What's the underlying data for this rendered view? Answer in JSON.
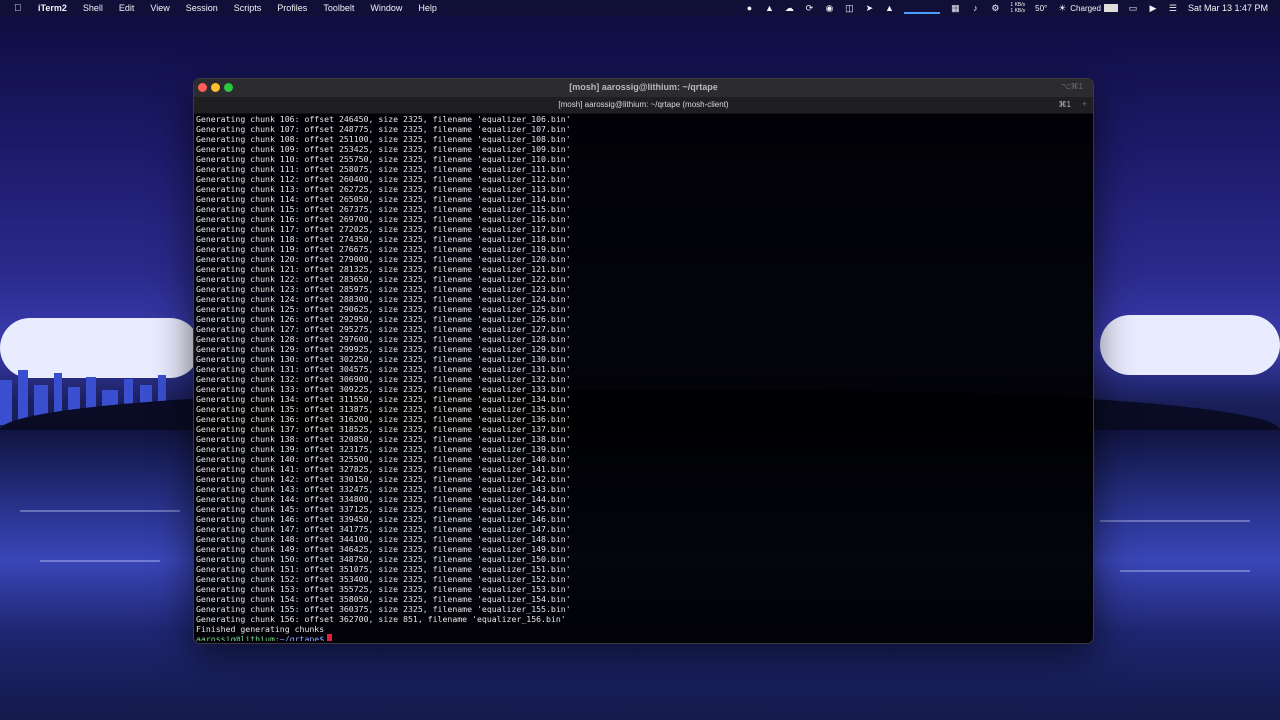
{
  "menubar": {
    "apple_icon": "apple-logo-icon",
    "items": [
      {
        "label": "iTerm2",
        "app": true
      },
      {
        "label": "Shell"
      },
      {
        "label": "Edit"
      },
      {
        "label": "View"
      },
      {
        "label": "Session"
      },
      {
        "label": "Scripts"
      },
      {
        "label": "Profiles"
      },
      {
        "label": "Toolbelt"
      },
      {
        "label": "Window"
      },
      {
        "label": "Help"
      }
    ],
    "tray": {
      "network": "1 KB/s",
      "network2": "1 KB/s",
      "weather": "50°",
      "battery": "Charged",
      "datetime": "Sat Mar 13  1:47 PM"
    }
  },
  "window": {
    "title": "[mosh] aarossig@lithium: ~/qrtape",
    "title_shortcut": "⌥⌘1",
    "tab_title": "[mosh] aarossig@lithium: ~/qrtape (mosh-client)",
    "tab_shortcut": "⌘1",
    "tab_add": "+"
  },
  "terminal": {
    "lines": [
      "Generating chunk 106: offset 246450, size 2325, filename 'equalizer_106.bin'",
      "Generating chunk 107: offset 248775, size 2325, filename 'equalizer_107.bin'",
      "Generating chunk 108: offset 251100, size 2325, filename 'equalizer_108.bin'",
      "Generating chunk 109: offset 253425, size 2325, filename 'equalizer_109.bin'",
      "Generating chunk 110: offset 255750, size 2325, filename 'equalizer_110.bin'",
      "Generating chunk 111: offset 258075, size 2325, filename 'equalizer_111.bin'",
      "Generating chunk 112: offset 260400, size 2325, filename 'equalizer_112.bin'",
      "Generating chunk 113: offset 262725, size 2325, filename 'equalizer_113.bin'",
      "Generating chunk 114: offset 265050, size 2325, filename 'equalizer_114.bin'",
      "Generating chunk 115: offset 267375, size 2325, filename 'equalizer_115.bin'",
      "Generating chunk 116: offset 269700, size 2325, filename 'equalizer_116.bin'",
      "Generating chunk 117: offset 272025, size 2325, filename 'equalizer_117.bin'",
      "Generating chunk 118: offset 274350, size 2325, filename 'equalizer_118.bin'",
      "Generating chunk 119: offset 276675, size 2325, filename 'equalizer_119.bin'",
      "Generating chunk 120: offset 279000, size 2325, filename 'equalizer_120.bin'",
      "Generating chunk 121: offset 281325, size 2325, filename 'equalizer_121.bin'",
      "Generating chunk 122: offset 283650, size 2325, filename 'equalizer_122.bin'",
      "Generating chunk 123: offset 285975, size 2325, filename 'equalizer_123.bin'",
      "Generating chunk 124: offset 288300, size 2325, filename 'equalizer_124.bin'",
      "Generating chunk 125: offset 290625, size 2325, filename 'equalizer_125.bin'",
      "Generating chunk 126: offset 292950, size 2325, filename 'equalizer_126.bin'",
      "Generating chunk 127: offset 295275, size 2325, filename 'equalizer_127.bin'",
      "Generating chunk 128: offset 297600, size 2325, filename 'equalizer_128.bin'",
      "Generating chunk 129: offset 299925, size 2325, filename 'equalizer_129.bin'",
      "Generating chunk 130: offset 302250, size 2325, filename 'equalizer_130.bin'",
      "Generating chunk 131: offset 304575, size 2325, filename 'equalizer_131.bin'",
      "Generating chunk 132: offset 306900, size 2325, filename 'equalizer_132.bin'",
      "Generating chunk 133: offset 309225, size 2325, filename 'equalizer_133.bin'",
      "Generating chunk 134: offset 311550, size 2325, filename 'equalizer_134.bin'",
      "Generating chunk 135: offset 313875, size 2325, filename 'equalizer_135.bin'",
      "Generating chunk 136: offset 316200, size 2325, filename 'equalizer_136.bin'",
      "Generating chunk 137: offset 318525, size 2325, filename 'equalizer_137.bin'",
      "Generating chunk 138: offset 320850, size 2325, filename 'equalizer_138.bin'",
      "Generating chunk 139: offset 323175, size 2325, filename 'equalizer_139.bin'",
      "Generating chunk 140: offset 325500, size 2325, filename 'equalizer_140.bin'",
      "Generating chunk 141: offset 327825, size 2325, filename 'equalizer_141.bin'",
      "Generating chunk 142: offset 330150, size 2325, filename 'equalizer_142.bin'",
      "Generating chunk 143: offset 332475, size 2325, filename 'equalizer_143.bin'",
      "Generating chunk 144: offset 334800, size 2325, filename 'equalizer_144.bin'",
      "Generating chunk 145: offset 337125, size 2325, filename 'equalizer_145.bin'",
      "Generating chunk 146: offset 339450, size 2325, filename 'equalizer_146.bin'",
      "Generating chunk 147: offset 341775, size 2325, filename 'equalizer_147.bin'",
      "Generating chunk 148: offset 344100, size 2325, filename 'equalizer_148.bin'",
      "Generating chunk 149: offset 346425, size 2325, filename 'equalizer_149.bin'",
      "Generating chunk 150: offset 348750, size 2325, filename 'equalizer_150.bin'",
      "Generating chunk 151: offset 351075, size 2325, filename 'equalizer_151.bin'",
      "Generating chunk 152: offset 353400, size 2325, filename 'equalizer_152.bin'",
      "Generating chunk 153: offset 355725, size 2325, filename 'equalizer_153.bin'",
      "Generating chunk 154: offset 358050, size 2325, filename 'equalizer_154.bin'",
      "Generating chunk 155: offset 360375, size 2325, filename 'equalizer_155.bin'",
      "Generating chunk 156: offset 362700, size 851, filename 'equalizer_156.bin'",
      "Finished generating chunks"
    ],
    "prompt_user": "aarossig@lithium",
    "prompt_path": ":~/qrtape$",
    "cursor_color": "#e0203a"
  }
}
